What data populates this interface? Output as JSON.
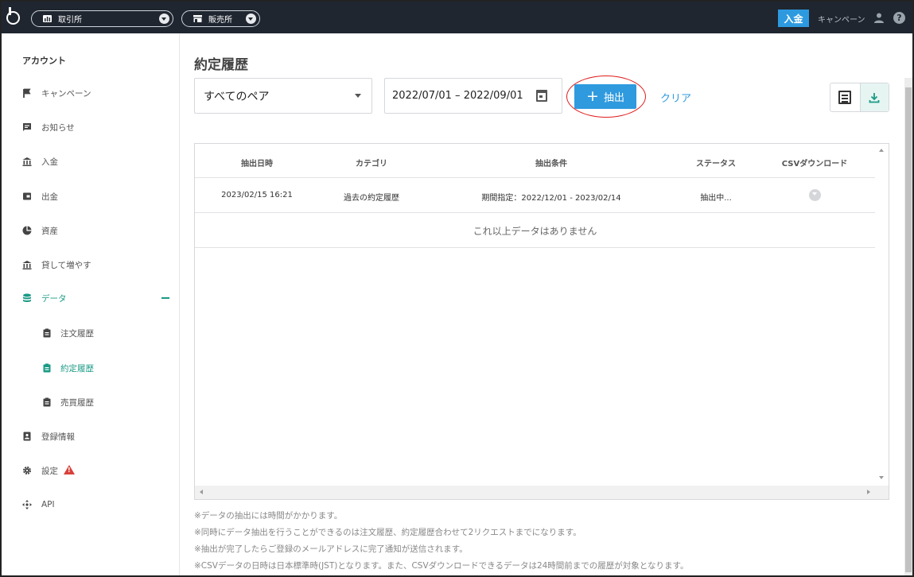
{
  "topbar": {
    "exchange_label": "取引所",
    "sales_label": "販売所",
    "deposit_button": "入金",
    "campaign_link": "キャンペーン",
    "help_glyph": "?"
  },
  "sidebar": {
    "header": "アカウント",
    "items": [
      {
        "label": "キャンペーン",
        "icon": "flag-icon"
      },
      {
        "label": "お知らせ",
        "icon": "message-icon"
      },
      {
        "label": "入金",
        "icon": "bank-icon"
      },
      {
        "label": "出金",
        "icon": "wallet-icon"
      },
      {
        "label": "資産",
        "icon": "pie-chart-icon"
      },
      {
        "label": "貸して増やす",
        "icon": "bank-icon"
      },
      {
        "label": "データ",
        "icon": "database-icon"
      },
      {
        "label": "注文履歴",
        "icon": "clipboard-icon"
      },
      {
        "label": "約定履歴",
        "icon": "clipboard-icon"
      },
      {
        "label": "売買履歴",
        "icon": "clipboard-icon"
      },
      {
        "label": "登録情報",
        "icon": "id-card-icon"
      },
      {
        "label": "設定",
        "icon": "gear-icon"
      },
      {
        "label": "API",
        "icon": "move-icon"
      }
    ]
  },
  "main": {
    "title": "約定履歴",
    "pair_select": "すべてのペア",
    "date_range": "2022/07/01 – 2022/09/01",
    "extract_button": "抽出",
    "clear_link": "クリア"
  },
  "table": {
    "columns": [
      "抽出日時",
      "カテゴリ",
      "抽出条件",
      "ステータス",
      "CSVダウンロード"
    ],
    "rows": [
      {
        "datetime": "2023/02/15 16:21",
        "category": "過去の約定履歴",
        "condition": "期間指定：2022/12/01 - 2023/02/14",
        "status": "抽出中..."
      }
    ],
    "no_more": "これ以上データはありません"
  },
  "notes": [
    "※データの抽出には時間がかかります。",
    "※同時にデータ抽出を行うことができるのは注文履歴、約定履歴合わせて2リクエストまでになります。",
    "※抽出が完了したらご登録のメールアドレスに完了通知が送信されます。",
    "※CSVデータの日時は日本標準時(JST)となります。また、CSVダウンロードできるデータは24時間前までの履歴が対象となります。"
  ],
  "colors": {
    "topbar_bg": "#1f2630",
    "accent_blue": "#2f9ade",
    "active_green": "#1a9a85",
    "highlight_red": "#e01b1b",
    "warning_red": "#d9413a"
  }
}
